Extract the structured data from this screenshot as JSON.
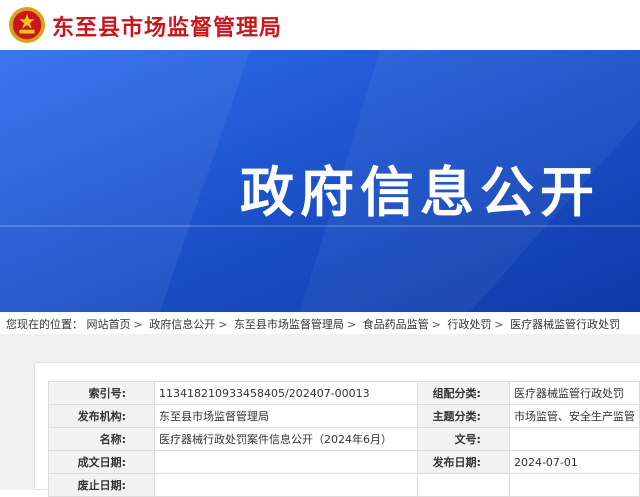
{
  "header": {
    "site_title": "东至县市场监督管理局"
  },
  "banner": {
    "title": "政府信息公开"
  },
  "breadcrumb": {
    "prefix": "您现在的位置：",
    "items": [
      "网站首页",
      "政府信息公开",
      "东至县市场监督管理局",
      "食品药品监管",
      "行政处罚",
      "医疗器械监管行政处罚"
    ]
  },
  "info_table": {
    "index_label": "索引号:",
    "index_value": "113418210933458405/202407-00013",
    "category_label": "组配分类:",
    "category_value": "医疗器械监管行政处罚",
    "publisher_label": "发布机构:",
    "publisher_value": "东至县市场监督管理局",
    "topic_label": "主题分类:",
    "topic_value": "市场监管、安全生产监管",
    "name_label": "名称:",
    "name_value": "医疗器械行政处罚案件信息公开（2024年6月）",
    "docno_label": "文号:",
    "docno_value": "",
    "created_label": "成文日期:",
    "created_value": "",
    "published_label": "发布日期:",
    "published_value": "2024-07-01",
    "expire_label": "废止日期:",
    "expire_value": ""
  },
  "colors": {
    "banner_blue": "#1a4fc6",
    "title_red": "#c8161d"
  }
}
